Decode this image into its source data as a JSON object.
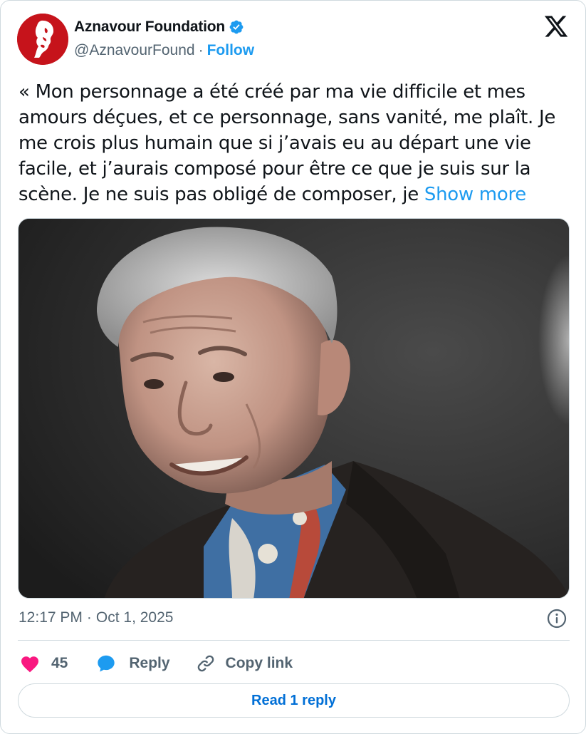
{
  "author": {
    "display_name": "Aznavour Foundation",
    "handle": "@AznavourFound",
    "separator": "·",
    "follow_label": "Follow",
    "verified": true,
    "avatar_color": "#c6131b"
  },
  "tweet": {
    "text": "« Mon personnage a été créé par ma vie difficile et mes amours déçues, et ce personnage, sans vanité, me plaît. Je me crois plus humain que si j’avais eu au départ une vie facile, et j’aurais composé pour être ce que je suis sur la scène. Je ne suis pas obligé de composer, je ",
    "show_more_label": "Show more"
  },
  "meta": {
    "time": "12:17 PM",
    "separator": "·",
    "date": "Oct 1, 2025"
  },
  "actions": {
    "like_count": "45",
    "reply_label": "Reply",
    "copy_label": "Copy link"
  },
  "read_replies_label": "Read 1 reply",
  "icons": {
    "logo": "x-logo-icon",
    "verified": "verified-badge-icon",
    "info": "info-icon",
    "like": "heart-icon",
    "reply": "speech-bubble-icon",
    "copy": "link-icon"
  },
  "colors": {
    "link_blue": "#1d9bf0",
    "verified_blue": "#1d9bf0",
    "heart_pink": "#f91880",
    "muted_text": "#536471",
    "read_button_text": "#006fd6"
  }
}
